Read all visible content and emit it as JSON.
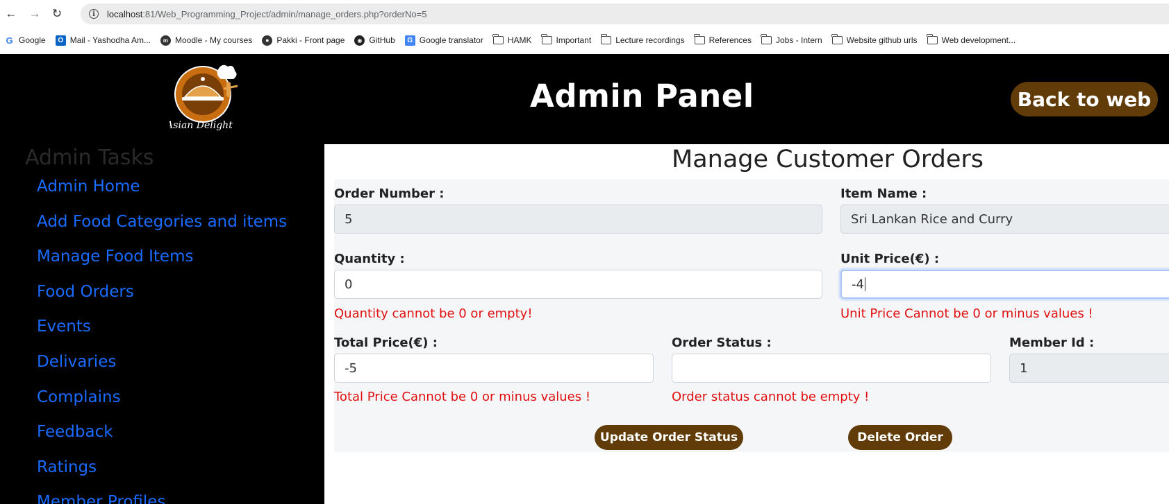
{
  "browser": {
    "url_host": "localhost",
    "url_rest": ":81/Web_Programming_Project/admin/manage_orders.php?orderNo=5",
    "bookmarks": [
      {
        "label": "Google",
        "icon": "google-icon"
      },
      {
        "label": "Mail - Yashodha Am...",
        "icon": "outlook-icon"
      },
      {
        "label": "Moodle - My courses",
        "icon": "moodle-icon"
      },
      {
        "label": "Pakki - Front page",
        "icon": "globe-icon"
      },
      {
        "label": "GitHub",
        "icon": "github-icon"
      },
      {
        "label": "Google translator",
        "icon": "translate-icon"
      },
      {
        "label": "HAMK",
        "icon": "folder-icon"
      },
      {
        "label": "Important",
        "icon": "folder-icon"
      },
      {
        "label": "Lecture recordings",
        "icon": "folder-icon"
      },
      {
        "label": "References",
        "icon": "folder-icon"
      },
      {
        "label": "Jobs - Intern",
        "icon": "folder-icon"
      },
      {
        "label": "Website github urls",
        "icon": "folder-icon"
      },
      {
        "label": "Web development...",
        "icon": "folder-icon"
      }
    ]
  },
  "header": {
    "logo_text": "Asian Delight",
    "title": "Admin Panel",
    "back_button": "Back to web"
  },
  "sidebar": {
    "title": "Admin Tasks",
    "items": [
      "Admin Home",
      "Add Food Categories and items",
      "Manage Food Items",
      "Food Orders",
      "Events",
      "Delivaries",
      "Complains",
      "Feedback",
      "Ratings",
      "Member Profiles"
    ]
  },
  "main": {
    "title": "Manage Customer Orders",
    "order_number": {
      "label": "Order Number :",
      "value": "5"
    },
    "item_name": {
      "label": "Item Name :",
      "value": "Sri Lankan Rice and Curry"
    },
    "quantity": {
      "label": "Quantity :",
      "value": "0",
      "error": "Quantity cannot be 0 or empty!"
    },
    "unit_price": {
      "label": "Unit Price(€) :",
      "value": "-4",
      "error": "Unit Price Cannot be 0 or minus values !"
    },
    "total_price": {
      "label": "Total Price(€) :",
      "value": "-5",
      "error": "Total Price Cannot be 0 or minus values !"
    },
    "order_status": {
      "label": "Order Status :",
      "value": "",
      "error": "Order status cannot be empty !"
    },
    "member_id": {
      "label": "Member Id :",
      "value": "1"
    },
    "update_button": "Update Order Status",
    "delete_button": "Delete Order"
  },
  "colors": {
    "accent_brown": "#613c08",
    "link_blue": "#1a6bff",
    "error_red": "#e01010"
  }
}
